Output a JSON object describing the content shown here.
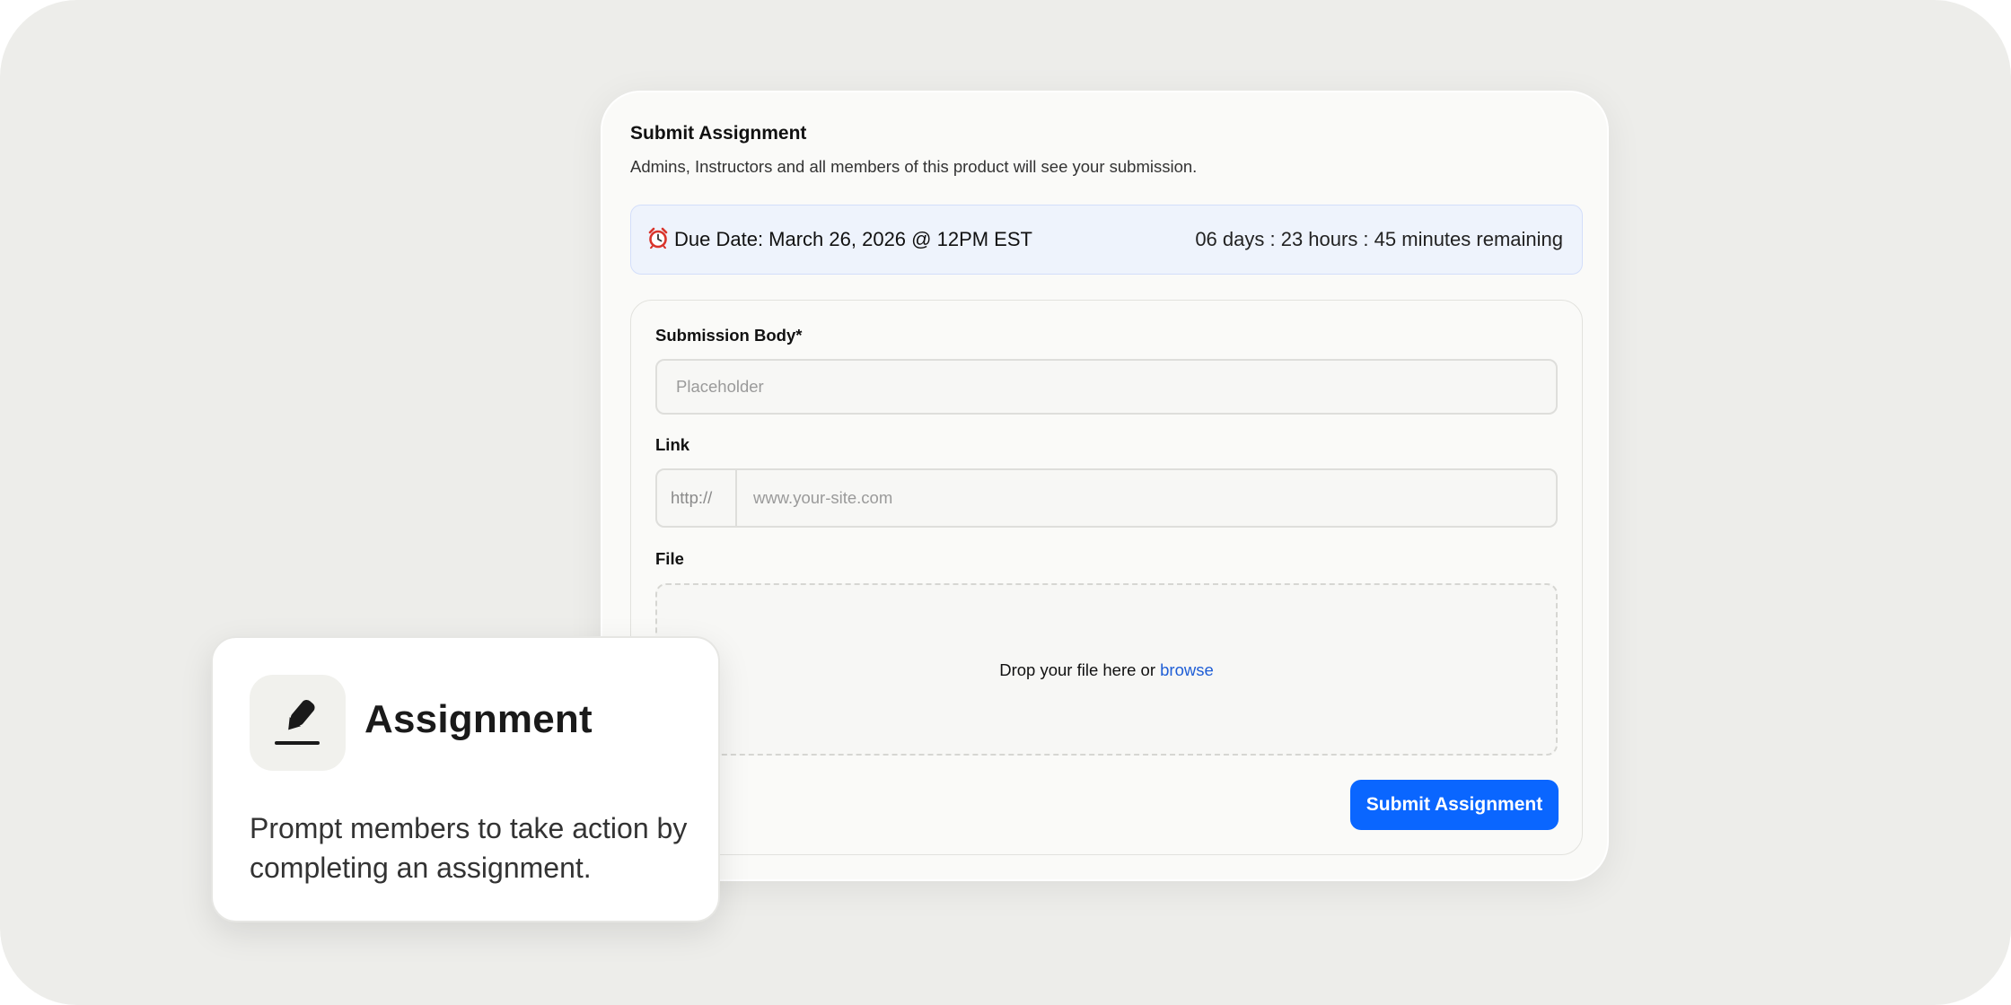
{
  "assignment_form": {
    "title": "Submit Assignment",
    "subtitle": "Admins, Instructors and all members of this product will see your submission.",
    "due": {
      "icon": "alarm-clock-icon",
      "label": "Due Date: March 26, 2026 @ 12PM EST",
      "remaining": "06 days : 23 hours : 45 minutes remaining"
    },
    "fields": {
      "body": {
        "label": "Submission Body*",
        "placeholder": "Placeholder"
      },
      "link": {
        "label": "Link",
        "prefix": "http://",
        "placeholder": "www.your-site.com"
      },
      "file": {
        "label": "File",
        "drop_text": "Drop your file here or ",
        "browse_label": "browse"
      }
    },
    "submit_label": "Submit Assignment"
  },
  "feature_card": {
    "icon": "pen-on-line-icon",
    "title": "Assignment",
    "description": "Prompt members to take action by completing an assignment."
  },
  "colors": {
    "accent": "#0a66ff",
    "link": "#1f5ed6",
    "banner_bg": "#eef3fc",
    "background": "#ededea"
  }
}
